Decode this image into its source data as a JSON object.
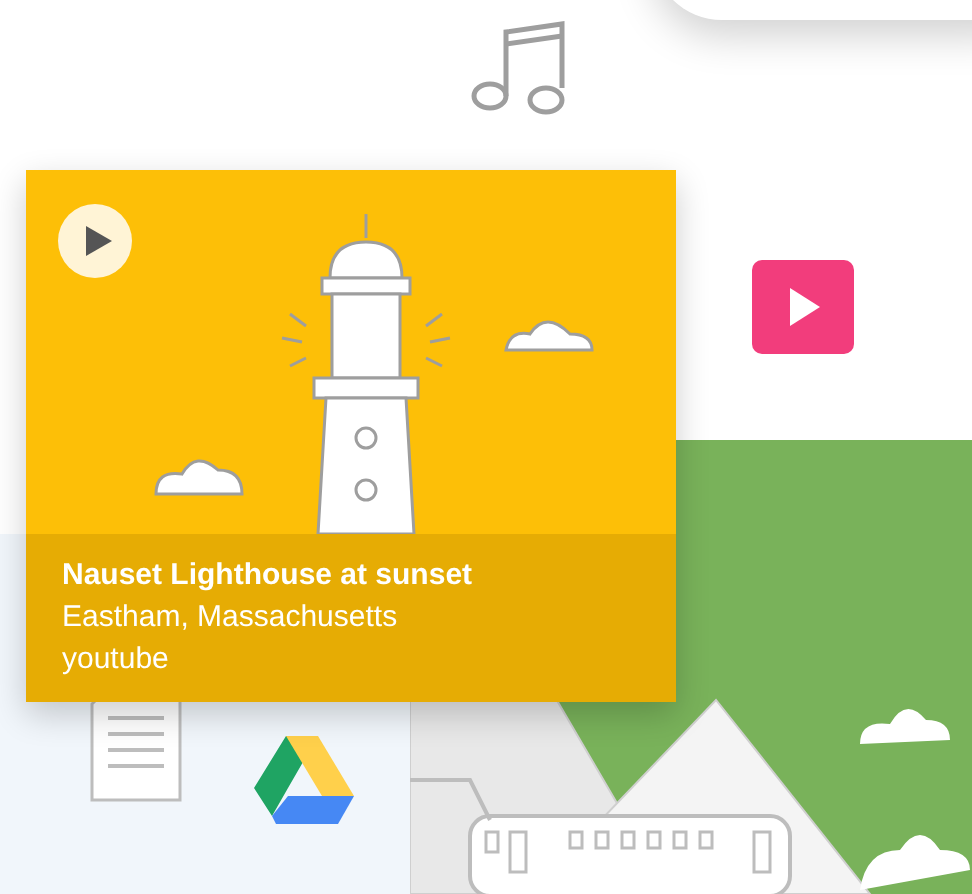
{
  "card": {
    "title": "Nauset Lighthouse at sunset",
    "location": "Eastham, Massachusetts",
    "source": "youtube"
  }
}
